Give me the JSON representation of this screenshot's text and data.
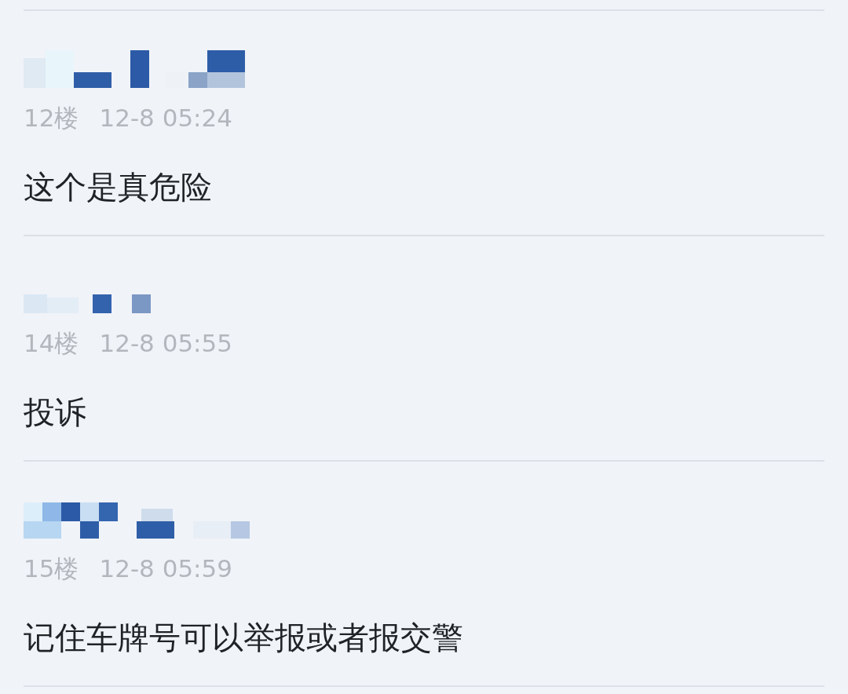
{
  "comments": [
    {
      "floor": "12楼",
      "time": "12-8 05:24",
      "text": "这个是真危险"
    },
    {
      "floor": "14楼",
      "time": "12-8 05:55",
      "text": "投诉"
    },
    {
      "floor": "15楼",
      "time": "12-8 05:59",
      "text": "记住车牌号可以举报或者报交警"
    }
  ]
}
